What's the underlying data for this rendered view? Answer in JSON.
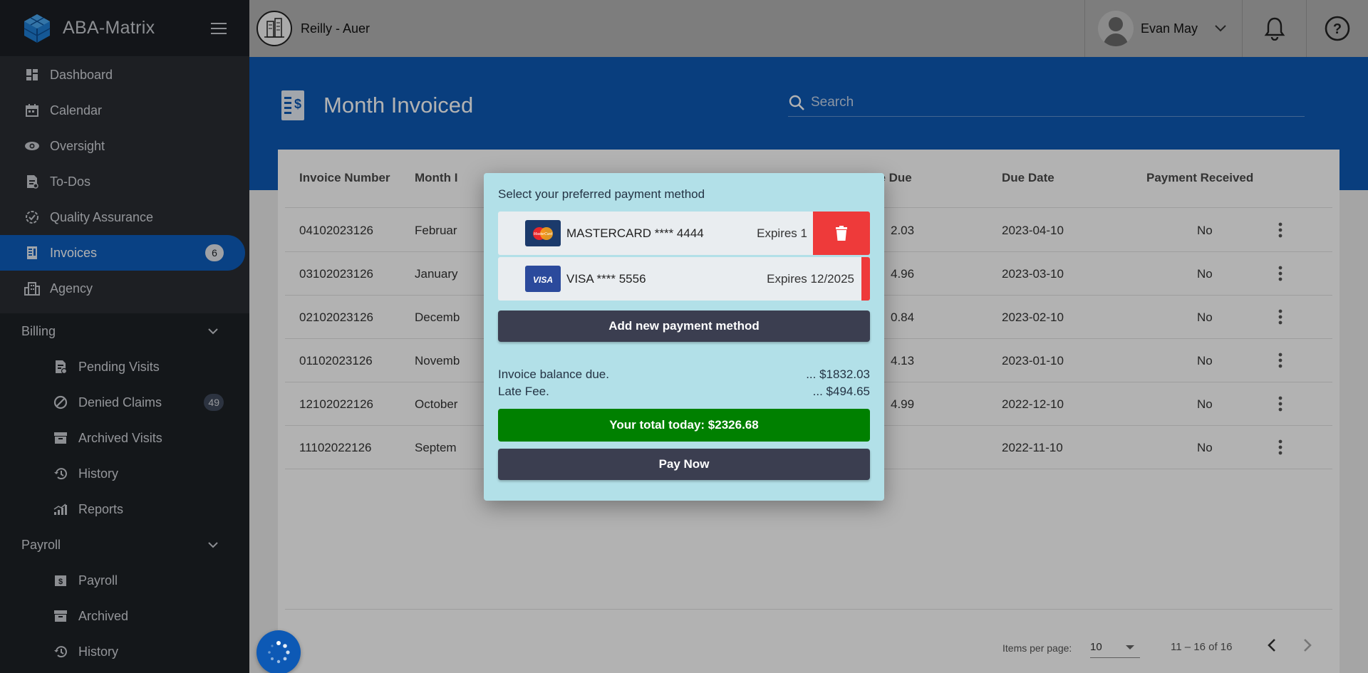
{
  "brand": {
    "name": "ABA-Matrix"
  },
  "sidebar": {
    "items": [
      {
        "label": "Dashboard",
        "icon": "dashboard-icon"
      },
      {
        "label": "Calendar",
        "icon": "calendar-icon"
      },
      {
        "label": "Oversight",
        "icon": "eye-icon"
      },
      {
        "label": "To-Dos",
        "icon": "todo-icon"
      },
      {
        "label": "Quality Assurance",
        "icon": "quality-icon"
      },
      {
        "label": "Invoices",
        "icon": "invoice-icon",
        "badge": "6",
        "active": true
      },
      {
        "label": "Agency",
        "icon": "building-icon"
      }
    ],
    "billing": {
      "label": "Billing",
      "items": [
        {
          "label": "Pending Visits",
          "icon": "pending-icon"
        },
        {
          "label": "Denied Claims",
          "icon": "denied-icon",
          "badge": "49"
        },
        {
          "label": "Archived Visits",
          "icon": "archive-icon"
        },
        {
          "label": "History",
          "icon": "history-icon"
        },
        {
          "label": "Reports",
          "icon": "reports-icon"
        }
      ]
    },
    "payroll": {
      "label": "Payroll",
      "items": [
        {
          "label": "Payroll",
          "icon": "payroll-icon"
        },
        {
          "label": "Archived",
          "icon": "archive-icon"
        },
        {
          "label": "History",
          "icon": "history-icon"
        }
      ]
    }
  },
  "topbar": {
    "org_name": "Reilly - Auer",
    "user_name": "Evan May"
  },
  "header": {
    "title": "Month Invoiced",
    "search_placeholder": "Search"
  },
  "table": {
    "columns": [
      "Invoice Number",
      "Month I",
      "ce Due",
      "Due Date",
      "Payment Received"
    ],
    "rows": [
      {
        "invoice": "04102023126",
        "month": "Februar",
        "due": "2.03",
        "due_date": "2023-04-10",
        "received": "No"
      },
      {
        "invoice": "03102023126",
        "month": "January",
        "due": "4.96",
        "due_date": "2023-03-10",
        "received": "No"
      },
      {
        "invoice": "02102023126",
        "month": "Decemb",
        "due": "0.84",
        "due_date": "2023-02-10",
        "received": "No"
      },
      {
        "invoice": "01102023126",
        "month": "Novemb",
        "due": "4.13",
        "due_date": "2023-01-10",
        "received": "No"
      },
      {
        "invoice": "12102022126",
        "month": "October",
        "due": "4.99",
        "due_date": "2022-12-10",
        "received": "No"
      },
      {
        "invoice": "11102022126",
        "month": "Septem",
        "due": "",
        "due_date": "2022-11-10",
        "received": "No"
      }
    ]
  },
  "paginator": {
    "items_label": "Items per page:",
    "page_size": "10",
    "range": "11 – 16 of 16"
  },
  "modal": {
    "title": "Select your preferred payment method",
    "methods": [
      {
        "brand": "MASTERCARD",
        "label": "MASTERCARD **** 4444",
        "expires": "Expires 1",
        "logo_text": "MasterCard"
      },
      {
        "brand": "VISA",
        "label": "VISA **** 5556",
        "expires": "Expires 12/2025",
        "logo_text": "VISA"
      }
    ],
    "add_label": "Add new payment method",
    "balance_label": "Invoice balance due.",
    "balance_value": "... $1832.03",
    "late_label": "Late Fee.",
    "late_value": "... $494.65",
    "total_label": "Your total today: $2326.68",
    "pay_label": "Pay Now"
  },
  "colors": {
    "sidebar": "#1e2126",
    "accent": "#0d59b5",
    "modal_bg": "#b2e0e8",
    "total_green": "#008000",
    "delete_red": "#ee3a3a"
  }
}
